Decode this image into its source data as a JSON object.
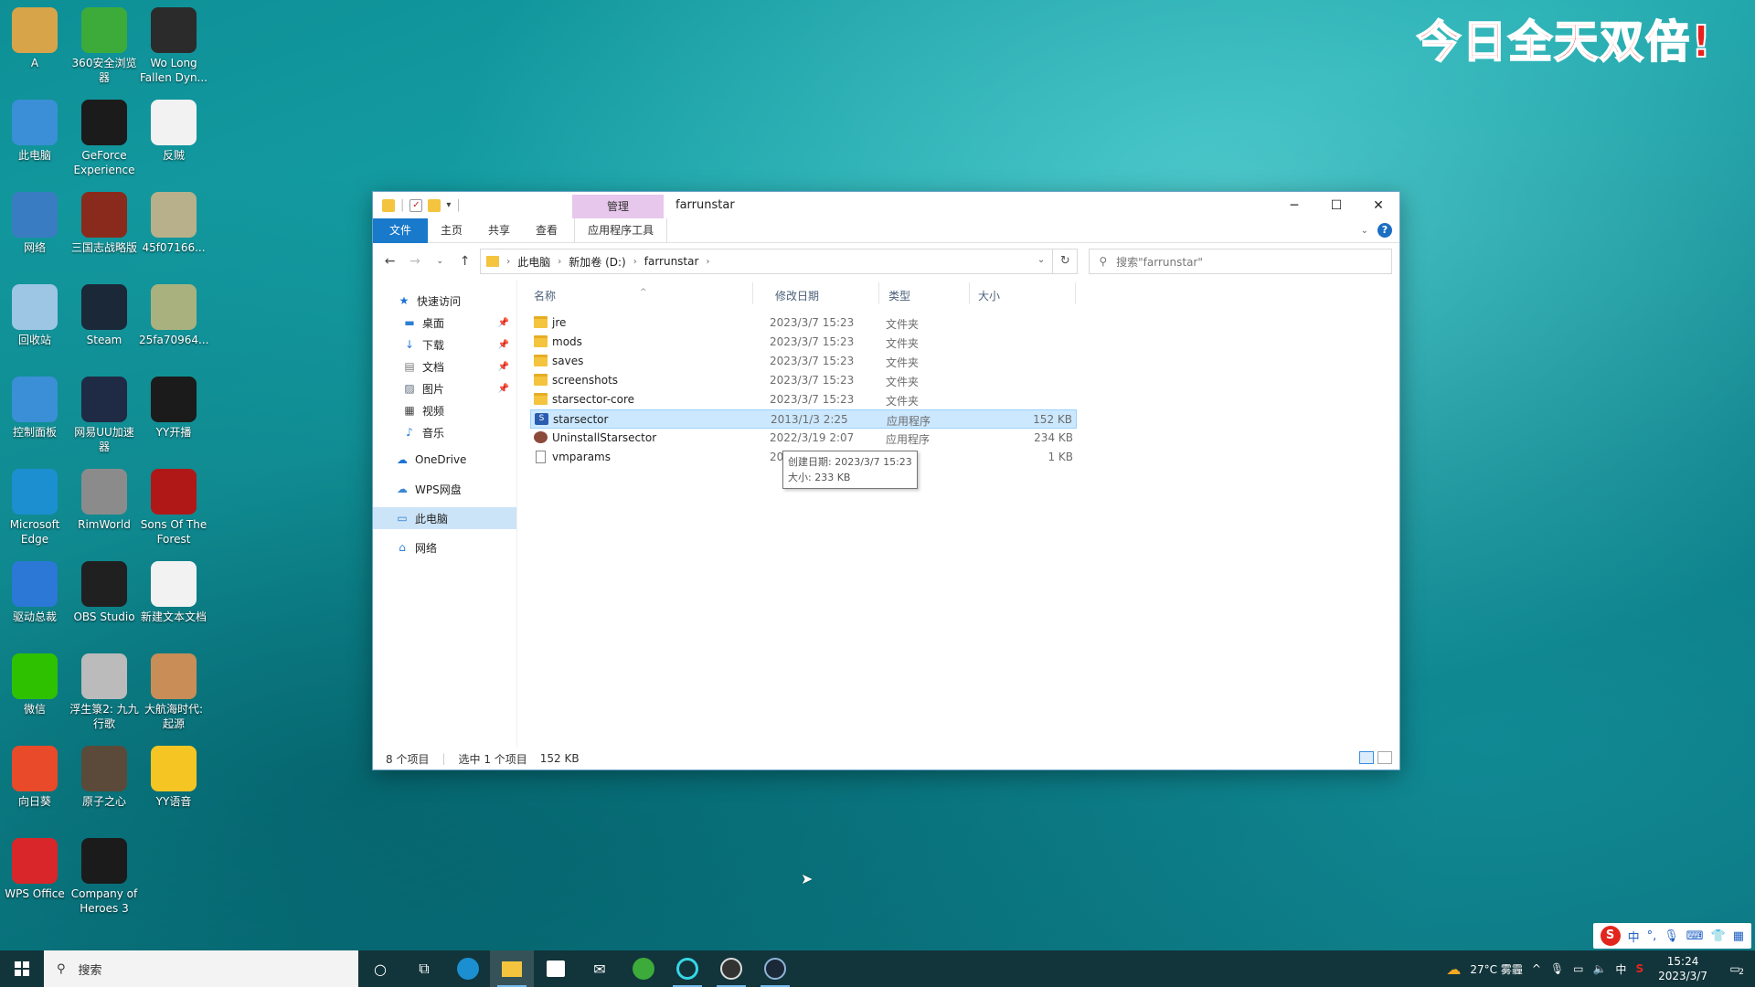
{
  "banner": "今日全天双倍!",
  "desktop_icons": [
    {
      "label": "A",
      "name": "user-folder",
      "color": "#d8a44a"
    },
    {
      "label": "360安全浏览器",
      "name": "360-browser",
      "color": "#3cab3a"
    },
    {
      "label": "Wo Long Fallen Dyn...",
      "name": "wolong",
      "color": "#2b2b2b"
    },
    {
      "label": "此电脑",
      "name": "this-pc",
      "color": "#3b8fd6"
    },
    {
      "label": "GeForce Experience",
      "name": "geforce",
      "color": "#1b1b1b"
    },
    {
      "label": "反贼",
      "name": "text-doc",
      "color": "#f2f2f2"
    },
    {
      "label": "网络",
      "name": "network",
      "color": "#3a7cc2"
    },
    {
      "label": "三国志战略版",
      "name": "sanguo",
      "color": "#8a2a1c"
    },
    {
      "label": "45f07166...",
      "name": "image-file",
      "color": "#b7b08a"
    },
    {
      "label": "回收站",
      "name": "recycle-bin",
      "color": "#9cc6e4"
    },
    {
      "label": "Steam",
      "name": "steam",
      "color": "#1b2838"
    },
    {
      "label": "25fa70964...",
      "name": "image-file-2",
      "color": "#a9b27e"
    },
    {
      "label": "控制面板",
      "name": "control-panel",
      "color": "#3b8fd6"
    },
    {
      "label": "网易UU加速器",
      "name": "uu-accelerator",
      "color": "#1f2a44"
    },
    {
      "label": "YY开播",
      "name": "yy-live",
      "color": "#1b1b1b"
    },
    {
      "label": "Microsoft Edge",
      "name": "edge",
      "color": "#1b8fd0"
    },
    {
      "label": "RimWorld",
      "name": "rimworld",
      "color": "#8b8b8b"
    },
    {
      "label": "Sons Of The Forest",
      "name": "sons-forest",
      "color": "#b01818"
    },
    {
      "label": "驱动总裁",
      "name": "driver",
      "color": "#2b78d6"
    },
    {
      "label": "OBS Studio",
      "name": "obs",
      "color": "#202020"
    },
    {
      "label": "新建文本文档",
      "name": "new-text",
      "color": "#f2f2f2"
    },
    {
      "label": "微信",
      "name": "wechat",
      "color": "#2dc100"
    },
    {
      "label": "浮生箓2: 九九行歌",
      "name": "fushenglu",
      "color": "#bbbbbb"
    },
    {
      "label": "大航海时代: 起源",
      "name": "uncharted-waters",
      "color": "#c98d57"
    },
    {
      "label": "向日葵",
      "name": "sunflower",
      "color": "#e84a2a"
    },
    {
      "label": "原子之心",
      "name": "atomic-heart",
      "color": "#5b4a3a"
    },
    {
      "label": "YY语音",
      "name": "yy-voice",
      "color": "#f5c623"
    },
    {
      "label": "WPS Office",
      "name": "wps",
      "color": "#d8262a"
    },
    {
      "label": "Company of Heroes 3",
      "name": "coh3",
      "color": "#1b1b1b"
    }
  ],
  "window": {
    "title": "farrunstar",
    "manage_tab": "管理",
    "tabs": [
      "文件",
      "主页",
      "共享",
      "查看",
      "应用程序工具"
    ],
    "address": [
      "此电脑",
      "新加卷 (D:)",
      "farrunstar"
    ],
    "search_placeholder": "搜索\"farrunstar\"",
    "nav": {
      "quick_access": "快速访问",
      "quick_items": [
        "桌面",
        "下载",
        "文档",
        "图片",
        "视频",
        "音乐"
      ],
      "onedrive": "OneDrive",
      "wps": "WPS网盘",
      "this_pc": "此电脑",
      "network": "网络"
    },
    "columns": [
      "名称",
      "修改日期",
      "类型",
      "大小"
    ],
    "files": [
      {
        "name": "jre",
        "date": "2023/3/7 15:23",
        "type": "文件夹",
        "size": "",
        "kind": "folder"
      },
      {
        "name": "mods",
        "date": "2023/3/7 15:23",
        "type": "文件夹",
        "size": "",
        "kind": "folder"
      },
      {
        "name": "saves",
        "date": "2023/3/7 15:23",
        "type": "文件夹",
        "size": "",
        "kind": "folder"
      },
      {
        "name": "screenshots",
        "date": "2023/3/7 15:23",
        "type": "文件夹",
        "size": "",
        "kind": "folder"
      },
      {
        "name": "starsector-core",
        "date": "2023/3/7 15:23",
        "type": "文件夹",
        "size": "",
        "kind": "folder"
      },
      {
        "name": "starsector",
        "date": "2013/1/3 2:25",
        "type": "应用程序",
        "size": "152 KB",
        "kind": "exe"
      },
      {
        "name": "UninstallStarsector",
        "date": "2022/3/19 2:07",
        "type": "应用程序",
        "size": "234 KB",
        "kind": "uninst"
      },
      {
        "name": "vmparams",
        "date": "2020/2/8 12:00",
        "type": "文件",
        "size": "1 KB",
        "kind": "file"
      }
    ],
    "tooltip": [
      "创建日期: 2023/3/7 15:23",
      "大小: 233 KB"
    ],
    "status": {
      "count": "8 个项目",
      "selected": "选中 1 个项目",
      "size": "152 KB"
    }
  },
  "taskbar": {
    "search_placeholder": "搜索",
    "weather": "27°C 雾霾",
    "ime": "中",
    "time": "15:24",
    "date": "2023/3/7",
    "notifications": "2"
  },
  "ime_bar": {
    "lang": "中"
  }
}
